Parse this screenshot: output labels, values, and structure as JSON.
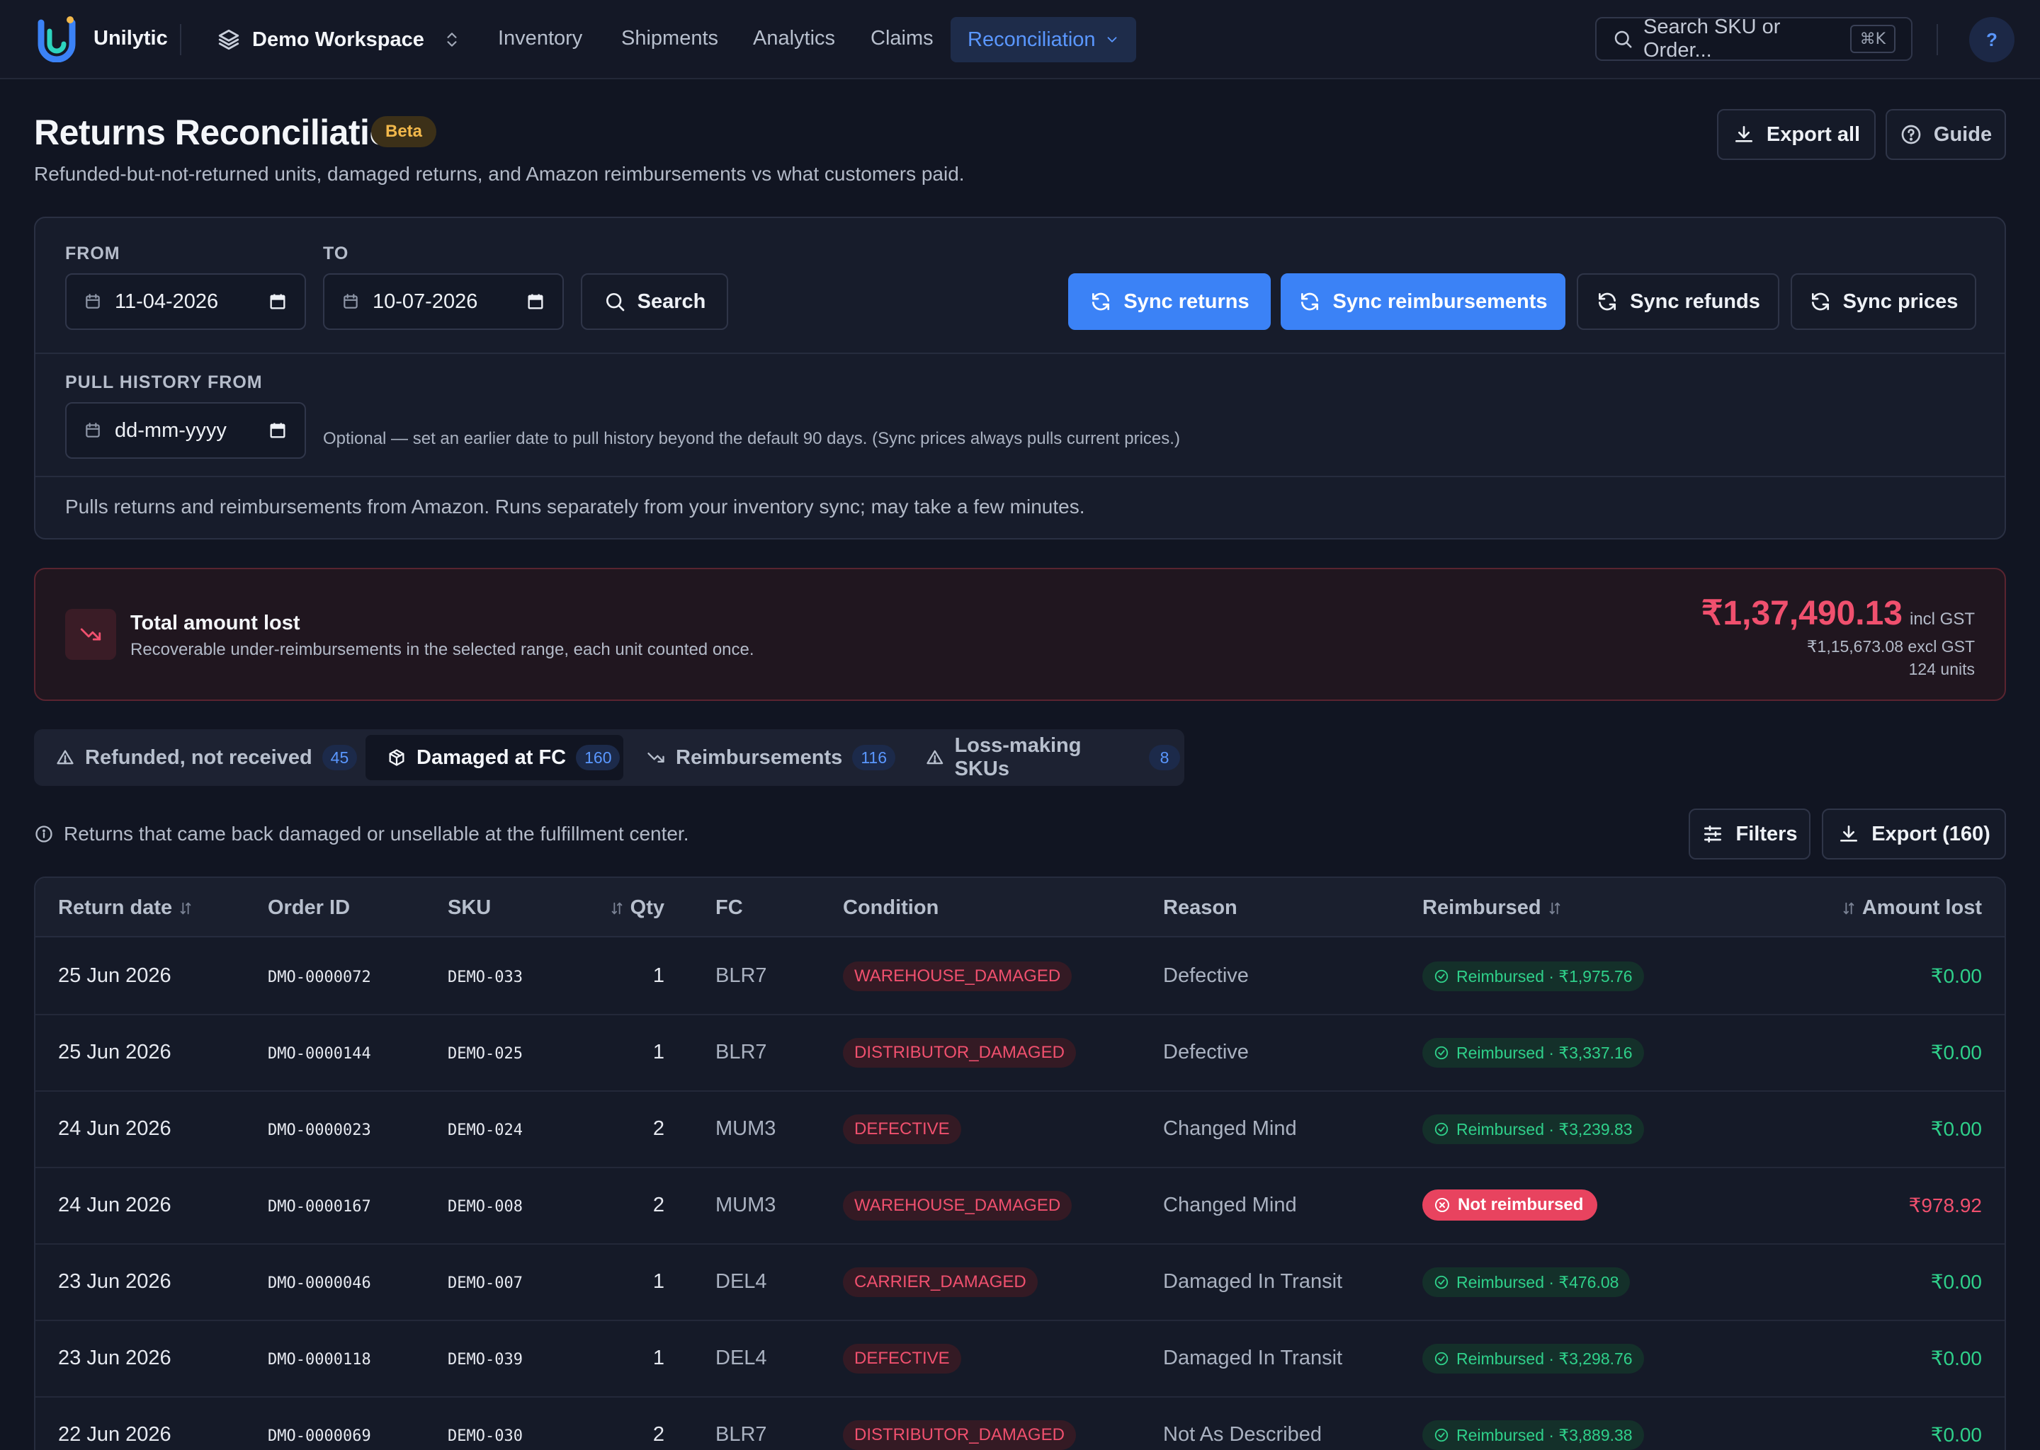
{
  "nav": {
    "brand": "Unilytic",
    "workspace": "Demo Workspace",
    "links": [
      "Inventory",
      "Shipments",
      "Analytics",
      "Claims"
    ],
    "active": "Reconciliation",
    "search_placeholder": "Search SKU or Order...",
    "search_shortcut": "⌘K",
    "help": "?"
  },
  "header": {
    "title": "Returns Reconciliation",
    "badge": "Beta",
    "subtitle": "Refunded-but-not-returned units, damaged returns, and Amazon reimbursements vs what customers paid.",
    "export_all": "Export all",
    "guide": "Guide"
  },
  "sync": {
    "from_label": "FROM",
    "from_value": "11-04-2026",
    "to_label": "TO",
    "to_value": "10-07-2026",
    "search_label": "Search",
    "buttons": [
      "Sync returns",
      "Sync reimbursements",
      "Sync refunds",
      "Sync prices"
    ],
    "history_label": "PULL HISTORY FROM",
    "history_placeholder": "dd-mm-yyyy",
    "history_hint": "Optional — set an earlier date to pull history beyond the default 90 days. (Sync prices always pulls current prices.)",
    "note": "Pulls returns and reimbursements from Amazon. Runs separately from your inventory sync; may take a few minutes."
  },
  "loss": {
    "title": "Total amount lost",
    "subtitle": "Recoverable under-reimbursements in the selected range, each unit counted once.",
    "amount": "₹1,37,490.13",
    "gst_label": "incl GST",
    "excl": "₹1,15,673.08 excl GST",
    "units": "124 units",
    "accent": "#f0506e"
  },
  "tabs": [
    {
      "label": "Refunded, not received",
      "count": "45",
      "icon": "alert-triangle-icon"
    },
    {
      "label": "Damaged at FC",
      "count": "160",
      "icon": "package-icon"
    },
    {
      "label": "Reimbursements",
      "count": "116",
      "icon": "trending-down-icon"
    },
    {
      "label": "Loss-making SKUs",
      "count": "8",
      "icon": "alert-triangle-icon"
    }
  ],
  "info": {
    "text": "Returns that came back damaged or unsellable at the fulfillment center.",
    "filters": "Filters",
    "export": "Export (160)"
  },
  "table": {
    "headers": [
      "Return date",
      "Order ID",
      "SKU",
      "Qty",
      "FC",
      "Condition",
      "Reason",
      "Reimbursed",
      "Amount lost"
    ],
    "rows": [
      {
        "date": "25 Jun 2026",
        "order": "DMO-0000072",
        "sku": "DEMO-033",
        "qty": "1",
        "fc": "BLR7",
        "condition": "WAREHOUSE_DAMAGED",
        "reason": "Defective",
        "reimbursed": "Reimbursed · ₹1,975.76",
        "status": "reimbursed",
        "amount": "₹0.00"
      },
      {
        "date": "25 Jun 2026",
        "order": "DMO-0000144",
        "sku": "DEMO-025",
        "qty": "1",
        "fc": "BLR7",
        "condition": "DISTRIBUTOR_DAMAGED",
        "reason": "Defective",
        "reimbursed": "Reimbursed · ₹3,337.16",
        "status": "reimbursed",
        "amount": "₹0.00"
      },
      {
        "date": "24 Jun 2026",
        "order": "DMO-0000023",
        "sku": "DEMO-024",
        "qty": "2",
        "fc": "MUM3",
        "condition": "DEFECTIVE",
        "reason": "Changed Mind",
        "reimbursed": "Reimbursed · ₹3,239.83",
        "status": "reimbursed",
        "amount": "₹0.00"
      },
      {
        "date": "24 Jun 2026",
        "order": "DMO-0000167",
        "sku": "DEMO-008",
        "qty": "2",
        "fc": "MUM3",
        "condition": "WAREHOUSE_DAMAGED",
        "reason": "Changed Mind",
        "reimbursed": "Not reimbursed",
        "status": "not",
        "amount": "₹978.92"
      },
      {
        "date": "23 Jun 2026",
        "order": "DMO-0000046",
        "sku": "DEMO-007",
        "qty": "1",
        "fc": "DEL4",
        "condition": "CARRIER_DAMAGED",
        "reason": "Damaged In Transit",
        "reimbursed": "Reimbursed · ₹476.08",
        "status": "reimbursed",
        "amount": "₹0.00"
      },
      {
        "date": "23 Jun 2026",
        "order": "DMO-0000118",
        "sku": "DEMO-039",
        "qty": "1",
        "fc": "DEL4",
        "condition": "DEFECTIVE",
        "reason": "Damaged In Transit",
        "reimbursed": "Reimbursed · ₹3,298.76",
        "status": "reimbursed",
        "amount": "₹0.00"
      },
      {
        "date": "22 Jun 2026",
        "order": "DMO-0000069",
        "sku": "DEMO-030",
        "qty": "2",
        "fc": "BLR7",
        "condition": "DISTRIBUTOR_DAMAGED",
        "reason": "Not As Described",
        "reimbursed": "Reimbursed · ₹3,889.38",
        "status": "reimbursed",
        "amount": "₹0.00"
      }
    ]
  }
}
